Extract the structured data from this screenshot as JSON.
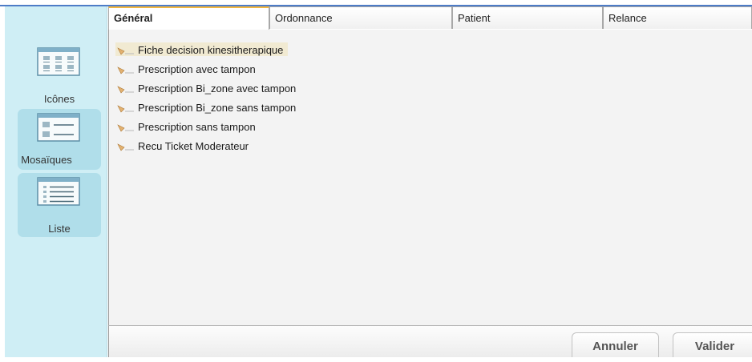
{
  "views": [
    {
      "label": "Icônes",
      "icon": "icons-view-icon"
    },
    {
      "label": "Mosaïques",
      "icon": "tiles-view-icon"
    },
    {
      "label": "Liste",
      "icon": "list-view-icon"
    }
  ],
  "tabs": [
    {
      "label": "Général",
      "active": true
    },
    {
      "label": "Ordonnance",
      "active": false
    },
    {
      "label": "Patient",
      "active": false
    },
    {
      "label": "Relance",
      "active": false
    }
  ],
  "documents": [
    {
      "label": "Fiche decision kinesitherapique",
      "selected": true
    },
    {
      "label": "Prescription avec tampon",
      "selected": false
    },
    {
      "label": "Prescription Bi_zone avec tampon",
      "selected": false
    },
    {
      "label": "Prescription Bi_zone sans tampon",
      "selected": false
    },
    {
      "label": "Prescription sans tampon",
      "selected": false
    },
    {
      "label": "Recu Ticket Moderateur",
      "selected": false
    }
  ],
  "footer": {
    "cancel_label": "Annuler",
    "confirm_label": "Valider"
  },
  "colors": {
    "sidebar_bg": "#cfeef5",
    "view_button_bg": "#b0deea",
    "active_tab_accent": "#f2b640",
    "selected_row_bg": "#f1ead2",
    "window_accent": "#4d7cc7"
  }
}
